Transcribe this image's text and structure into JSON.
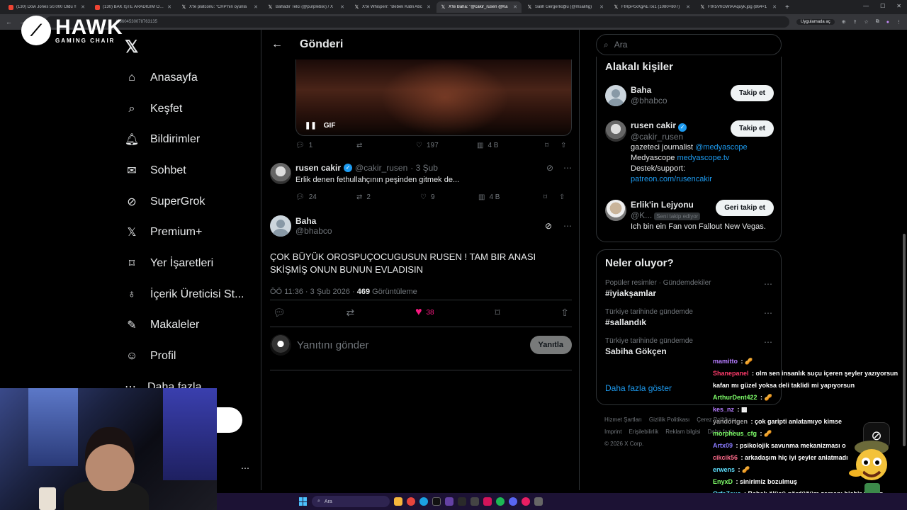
{
  "browser": {
    "tabs": [
      {
        "label": "(130) Dow Jones 50.000 Oldu !!",
        "icon": "youtube-icon"
      },
      {
        "label": "(130) BAK İŞTE ARADIĞIM OYU",
        "icon": "youtube-icon"
      },
      {
        "label": "X'te platconu: \"CHP'nin oyunla",
        "icon": "x-icon"
      },
      {
        "label": "Bahadır Telci (@purplebixi) / X",
        "icon": "x-icon"
      },
      {
        "label": "X'te Whisperr: \"Bebek Katili Abc",
        "icon": "x-icon"
      },
      {
        "label": "X'te Baha: \"@cakir_rusen @Ka",
        "icon": "x-icon",
        "active": true
      },
      {
        "label": "Salih Gergerlioğlu (@msalihg)",
        "icon": "x-icon"
      },
      {
        "label": "FtRpPcxXgAETxi1 (1080×807)",
        "icon": "x-icon"
      },
      {
        "label": "FtR5VhGWIAAquyk.jpg (864×1",
        "icon": "x-icon"
      }
    ],
    "new_tab": "+",
    "url": "/1860453007876313​5",
    "app_pill": "Uygulamada aç"
  },
  "overlay_logo": {
    "brand": "HAWK",
    "subtitle": "GAMING CHAIR"
  },
  "sidebar": {
    "items": [
      {
        "label": "Anasayfa",
        "icon": "home-icon"
      },
      {
        "label": "Keşfet",
        "icon": "search-icon"
      },
      {
        "label": "Bildirimler",
        "icon": "bell-icon"
      },
      {
        "label": "Sohbet",
        "icon": "mail-icon"
      },
      {
        "label": "SuperGrok",
        "icon": "grok-icon"
      },
      {
        "label": "Premium+",
        "icon": "x-premium-icon"
      },
      {
        "label": "Yer İşaretleri",
        "icon": "bookmark-icon"
      },
      {
        "label": "İçerik Üreticisi St...",
        "icon": "creator-icon"
      },
      {
        "label": "Makaleler",
        "icon": "articles-icon"
      },
      {
        "label": "Profil",
        "icon": "person-icon"
      }
    ],
    "more_label": "Daha fazla"
  },
  "post_header": {
    "title": "Gönderi"
  },
  "media": {
    "badge": "GIF"
  },
  "first_actions": {
    "replies": "1",
    "reposts": "",
    "likes": "197",
    "views": "4 B"
  },
  "reply_tweet": {
    "name": "rusen cakir",
    "handle": "@cakir_rusen",
    "time": "· 3 Şub",
    "text": "Erlik denen fethullahçının peşinden gitmek de...",
    "replies": "24",
    "reposts": "2",
    "likes": "9",
    "views": "4 B"
  },
  "main_tweet": {
    "name": "Baha",
    "handle": "@bhabco",
    "text": "ÇOK BÜYÜK OROSPUÇOCUGUSUN RUSEN ! TAM BIR ANASI SKİŞMİŞ ONUN BUNUN EVLADISIN",
    "time": "ÖÖ 11:36 · 3 Şub 2026 ·",
    "views_count": "469",
    "views_label": "Görüntüleme",
    "likes": "38"
  },
  "reply_box": {
    "placeholder": "Yanıtını gönder",
    "button": "Yanıtla"
  },
  "search": {
    "placeholder": "Ara"
  },
  "related": {
    "title": "Alakalı kişiler",
    "people": [
      {
        "name": "Baha",
        "handle": "@bhabco",
        "button": "Takip et"
      },
      {
        "name": "rusen cakir",
        "handle": "@cakir_rusen",
        "button": "Takip et",
        "bio_1": "gazeteci journalist ",
        "bio_1_link": "@medyascope",
        "bio_2": "Medyascope ",
        "bio_2_link": "medyascope.tv",
        "bio_3": "Destek/support:",
        "bio_4_link": "patreon.com/rusencakir"
      },
      {
        "name": "Erlik'in Lejyonu",
        "handle": "@K...",
        "follows_you": "Seni takip ediyor",
        "button": "Geri takip et",
        "bio_1": "Ich bin ein Fan von Fallout New Vegas."
      }
    ]
  },
  "trends": {
    "title": "Neler oluyor?",
    "items": [
      {
        "category": "Popüler resimler · Gündemdekiler",
        "name": "#iyiakşamlar"
      },
      {
        "category": "Türkiye tarihinde gündemde",
        "name": "#sallandık"
      },
      {
        "category": "Türkiye tarihinde gündemde",
        "name": "Sabiha Gökçen"
      }
    ],
    "show_more": "Daha fazla göster"
  },
  "footer": {
    "links_row1": [
      "Hizmet Şartları",
      "Gizlilik Politikası",
      "Çerez Politikası"
    ],
    "links_row2": [
      "Imprint",
      "Erişilebilirlik",
      "Reklam bilgisi",
      "Daha fazla ..."
    ],
    "copyright": "© 2026 X Corp."
  },
  "chat": [
    {
      "user": "mamitto",
      "color": "#b57cff",
      "msg": "🥜"
    },
    {
      "user": "Shanepanel",
      "color": "#ff3b6b",
      "msg": "olm sen insanlık suçu içeren şeyler yazıyorsun kafan mı güzel yoksa deli taklidi mi yapıyorsun"
    },
    {
      "user": "ArthurDent422",
      "color": "#7fff6a",
      "msg": "🥜"
    },
    {
      "user": "kes_nz",
      "color": "#b57cff",
      "msg": "▩"
    },
    {
      "user": "yandortgen",
      "color": "#a5a5a5",
      "msg": "çok garipti anlatamıyo kimse"
    },
    {
      "user": "morpheus_cfg",
      "color": "#7fff6a",
      "msg": "🥜"
    },
    {
      "user": "Artx09",
      "color": "#8a7bff",
      "msg": "psikolojik savunma mekanizması o"
    },
    {
      "user": "cikcik56",
      "color": "#ff6b8b",
      "msg": "arkadaşım hiç iyi şeyler anlatmadı"
    },
    {
      "user": "erwens",
      "color": "#5ee0ff",
      "msg": "🥜"
    },
    {
      "user": "EnyxD",
      "color": "#7fff6a",
      "msg": "sinirimiz bozulmuş"
    },
    {
      "user": "OrfeZeus",
      "color": "#5ee0ff",
      "msg": "Bebek ölüsü gördüğüm zamanı hiçbir zaman unutamicam. Hiçbir sözcük anlatamaz o duyguları"
    }
  ],
  "taskbar": {
    "search": "Ara"
  },
  "colors": {
    "accent": "#1d9bf0",
    "like": "#f91880",
    "border": "#2f3336",
    "muted": "#71767b"
  }
}
